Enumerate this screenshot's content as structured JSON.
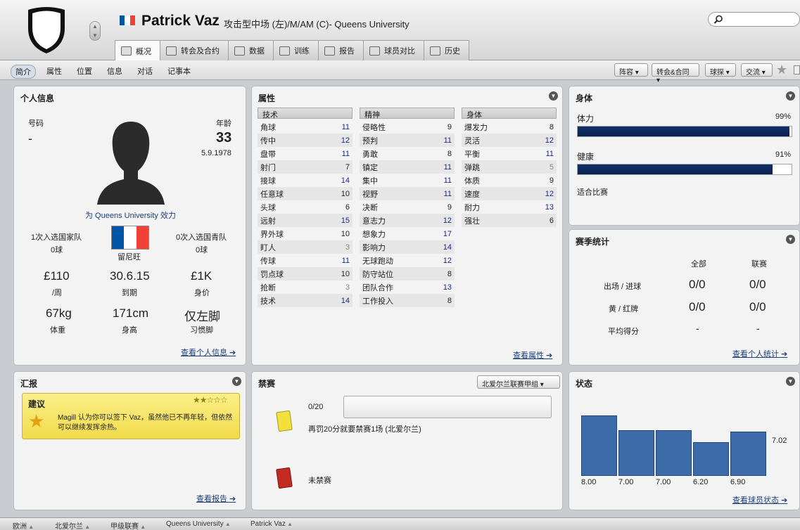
{
  "header": {
    "name": "Patrick Vaz",
    "subtitle": "攻击型中场 (左)/M/AM (C)- Queens University",
    "search_placeholder": "",
    "flag_colors": [
      "#0055a4",
      "#ffffff",
      "#ef4135"
    ]
  },
  "tabs": [
    {
      "label": "概况",
      "icon": "overview-icon"
    },
    {
      "label": "转会及合约",
      "icon": "document-icon"
    },
    {
      "label": "数据",
      "icon": "chart-icon"
    },
    {
      "label": "训练",
      "icon": "ball-icon"
    },
    {
      "label": "报告",
      "icon": "report-icon"
    },
    {
      "label": "球员对比",
      "icon": "compare-icon"
    },
    {
      "label": "历史",
      "icon": "history-icon"
    }
  ],
  "subnav": {
    "items": [
      "简介",
      "属性",
      "位置",
      "信息",
      "对话",
      "记事本"
    ],
    "dropdowns": [
      "阵容",
      "转会&合同",
      "球探",
      "交流"
    ]
  },
  "personal": {
    "title": "个人信息",
    "number_label": "号码",
    "number": "-",
    "age_label": "年龄",
    "age": "33",
    "dob": "5.9.1978",
    "plays_for": "为 Queens University 效力",
    "caps_label": "1次入选国家队",
    "caps_goals": "0球",
    "youth_caps_label": "0次入选国青队",
    "youth_goals": "0球",
    "nationality": "留尼旺",
    "wage": "£110",
    "wage_label": "/周",
    "expires": "30.6.15",
    "expires_label": "到期",
    "value": "£1K",
    "value_label": "身价",
    "weight": "67kg",
    "weight_label": "体重",
    "height": "171cm",
    "height_label": "身高",
    "foot": "仅左脚",
    "foot_label": "习惯脚",
    "link": "查看个人信息"
  },
  "attributes": {
    "title": "属性",
    "technical_head": "技术",
    "mental_head": "精神",
    "physical_head": "身体",
    "technical": [
      [
        "角球",
        "11"
      ],
      [
        "传中",
        "12"
      ],
      [
        "盘带",
        "11"
      ],
      [
        "射门",
        "7"
      ],
      [
        "接球",
        "14"
      ],
      [
        "任意球",
        "10"
      ],
      [
        "头球",
        "6"
      ],
      [
        "远射",
        "15"
      ],
      [
        "界外球",
        "10"
      ],
      [
        "盯人",
        "3"
      ],
      [
        "传球",
        "11"
      ],
      [
        "罚点球",
        "10"
      ],
      [
        "抢断",
        "3"
      ],
      [
        "技术",
        "14"
      ]
    ],
    "mental": [
      [
        "侵略性",
        "9"
      ],
      [
        "预判",
        "11"
      ],
      [
        "勇敢",
        "8"
      ],
      [
        "镇定",
        "11"
      ],
      [
        "集中",
        "11"
      ],
      [
        "视野",
        "11"
      ],
      [
        "决断",
        "9"
      ],
      [
        "意志力",
        "12"
      ],
      [
        "想象力",
        "17"
      ],
      [
        "影响力",
        "14"
      ],
      [
        "无球跑动",
        "12"
      ],
      [
        "防守站位",
        "8"
      ],
      [
        "团队合作",
        "13"
      ],
      [
        "工作投入",
        "8"
      ]
    ],
    "physical": [
      [
        "爆发力",
        "8"
      ],
      [
        "灵活",
        "12"
      ],
      [
        "平衡",
        "11"
      ],
      [
        "弹跳",
        "5"
      ],
      [
        "体质",
        "9"
      ],
      [
        "速度",
        "12"
      ],
      [
        "耐力",
        "13"
      ],
      [
        "强壮",
        "6"
      ]
    ],
    "link": "查看属性"
  },
  "physical_condition": {
    "title": "身体",
    "fitness_label": "体力",
    "fitness": "99%",
    "fitness_value": 0.99,
    "health_label": "健康",
    "health": "91%",
    "health_value": 0.91,
    "match_fit": "适合比赛"
  },
  "season_stats": {
    "title": "赛季统计",
    "col_all": "全部",
    "col_league": "联赛",
    "rows": [
      {
        "label": "出场 / 进球",
        "all": "0/0",
        "league": "0/0"
      },
      {
        "label": "黄 / 红牌",
        "all": "0/0",
        "league": "0/0"
      },
      {
        "label": "平均得分",
        "all": "-",
        "league": "-"
      }
    ],
    "link": "查看个人统计"
  },
  "report": {
    "title": "汇报",
    "box_title": "建议",
    "text": "Magill 认为你可以签下 Vaz，虽然他已不再年轻，但依然可以继续发挥余热。",
    "stars": "★★☆☆☆",
    "link": "查看报告"
  },
  "bans": {
    "title": "禁赛",
    "league_select": "北爱尔兰联赛甲组",
    "points": "0/20",
    "points_value": 0,
    "yellow_text": "再罚20分就要禁赛1场 (北爱尔兰)",
    "red_text": "未禁赛"
  },
  "form": {
    "title": "状态",
    "average": "7.02",
    "link": "查看球员状态",
    "ratings": [
      "8.00",
      "7.00",
      "7.00",
      "6.20",
      "6.90"
    ]
  },
  "chart_data": {
    "type": "bar",
    "categories": [
      "1",
      "2",
      "3",
      "4",
      "5"
    ],
    "values": [
      8.0,
      7.0,
      7.0,
      6.2,
      6.9
    ],
    "title": "状态",
    "xlabel": "",
    "ylabel": "",
    "ylim": [
      4,
      9
    ],
    "average_label": "7.02"
  },
  "breadcrumbs": [
    "欧洲",
    "北爱尔兰",
    "甲级联赛",
    "Queens University",
    "Patrick Vaz"
  ]
}
